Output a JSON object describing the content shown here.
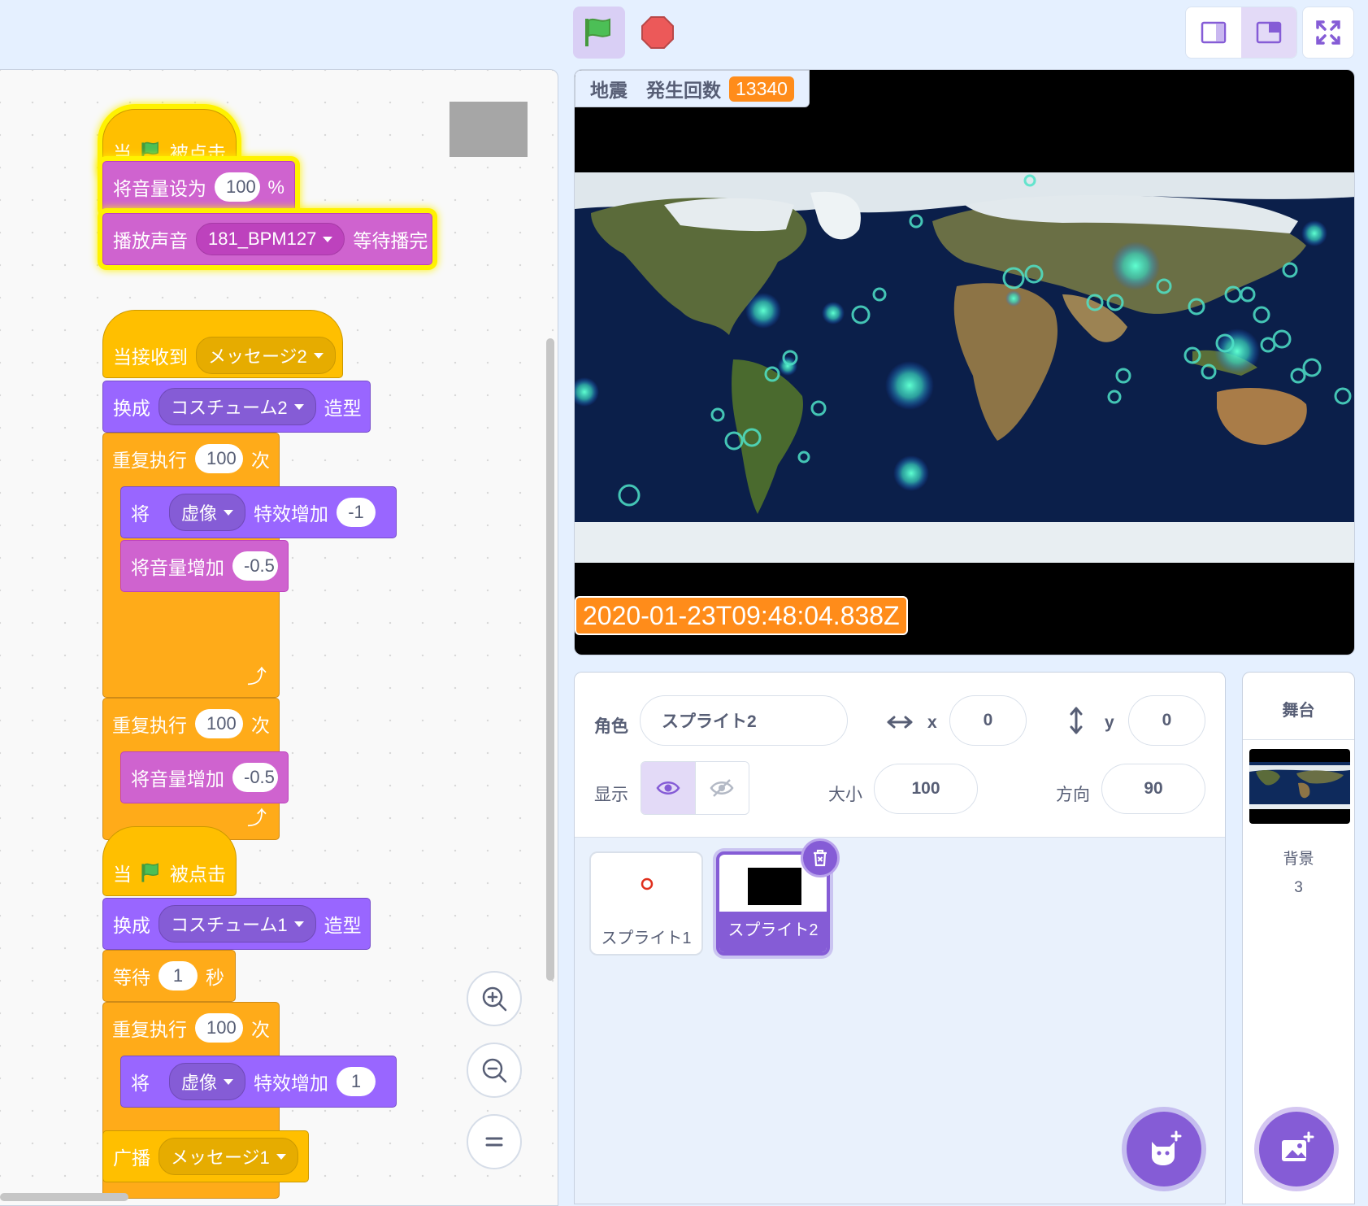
{
  "toolbar": {
    "green_flag": "green-flag",
    "stop": "stop-sign",
    "layout_small": "small-stage-layout",
    "layout_normal": "normal-stage-layout",
    "fullscreen": "fullscreen"
  },
  "scripts": {
    "script1": {
      "hat_when": "当",
      "hat_clicked": "被点击",
      "set_volume": "将音量设为",
      "set_volume_value": "100",
      "set_volume_unit": "%",
      "play_sound": "播放声音",
      "sound_name": "181_BPM127",
      "play_until": "等待播完"
    },
    "script2": {
      "when_receive": "当接收到",
      "message": "メッセージ2",
      "switch": "换成",
      "costume": "コスチューム2",
      "costume_suffix": "造型",
      "repeat1": "重复执行",
      "repeat1_value": "100",
      "repeat1_unit": "次",
      "change_effect_prefix": "将",
      "effect_name": "虚像",
      "change_effect_mid": "特效增加",
      "effect_value": "-1",
      "change_volume1": "将音量增加",
      "change_volume1_value": "-0.5",
      "repeat2": "重复执行",
      "repeat2_value": "100",
      "repeat2_unit": "次",
      "change_volume2": "将音量增加",
      "change_volume2_value": "-0.5"
    },
    "script3": {
      "hat_when": "当",
      "hat_clicked": "被点击",
      "switch": "换成",
      "costume": "コスチューム1",
      "costume_suffix": "造型",
      "wait": "等待",
      "wait_value": "1",
      "wait_unit": "秒",
      "repeat": "重复执行",
      "repeat_value": "100",
      "repeat_unit": "次",
      "change_effect_prefix": "将",
      "effect_name": "虚像",
      "change_effect_mid": "特效增加",
      "effect_value": "1",
      "broadcast": "广播",
      "broadcast_message": "メッセージ1"
    }
  },
  "stage": {
    "monitor_label": "地震　発生回数",
    "monitor_value": "13340",
    "date_monitor": "2020-01-23T09:48:04.838Z"
  },
  "sprite_info": {
    "sprite_label": "角色",
    "sprite_name": "スプライト2",
    "x_label": "x",
    "x_value": "0",
    "y_label": "y",
    "y_value": "0",
    "show_label": "显示",
    "size_label": "大小",
    "size_value": "100",
    "direction_label": "方向",
    "direction_value": "90"
  },
  "sprites": [
    {
      "name": "スプライト1",
      "selected": false
    },
    {
      "name": "スプライト2",
      "selected": true
    }
  ],
  "stage_panel": {
    "title": "舞台",
    "backdrop_label": "背景",
    "backdrop_count": "3"
  },
  "colors": {
    "events": "#ffbf00",
    "control": "#ffab19",
    "sound": "#cf63cf",
    "looks": "#9966ff",
    "accent": "#855cd6",
    "monitor": "#ff8c1a"
  }
}
